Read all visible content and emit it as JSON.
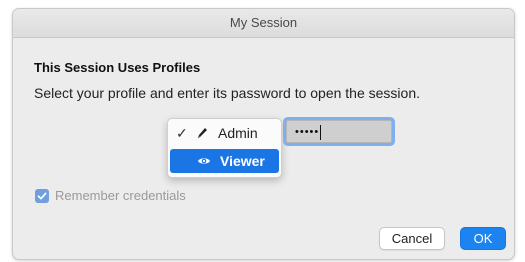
{
  "window": {
    "title": "My Session"
  },
  "dialog": {
    "heading": "This Session Uses Profiles",
    "message": "Select your profile and enter its password to open the session."
  },
  "profile_menu": {
    "items": [
      {
        "label": "Admin",
        "icon": "pencil-icon",
        "checked": true
      },
      {
        "label": "Viewer",
        "icon": "eye-icon",
        "highlighted": true
      }
    ],
    "checkmark": "✓"
  },
  "password": {
    "masked_value": "•••••"
  },
  "remember": {
    "label": "Remember credentials",
    "checked": true
  },
  "buttons": {
    "cancel": "Cancel",
    "ok": "OK"
  },
  "colors": {
    "accent": "#1b84f0",
    "highlight": "#1b76e5",
    "checkbox": "#6f9fdc"
  }
}
